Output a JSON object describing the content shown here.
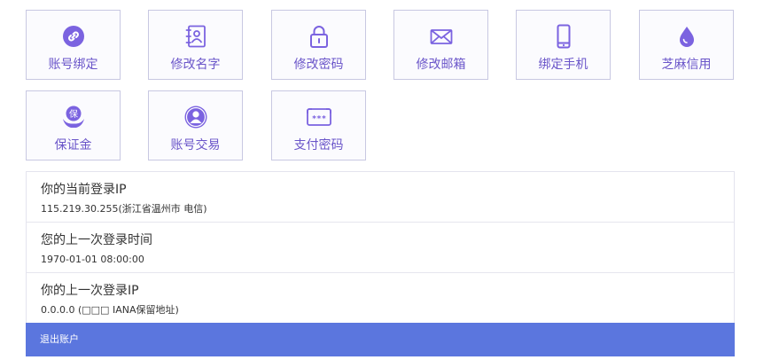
{
  "colors": {
    "accent": "#7b63e0",
    "tile_border": "#c8c8e2",
    "logout_bg": "#5b76de"
  },
  "tiles": [
    {
      "label": "账号绑定",
      "icon": "link-icon"
    },
    {
      "label": "修改名字",
      "icon": "contact-card-icon"
    },
    {
      "label": "修改密码",
      "icon": "lock-icon"
    },
    {
      "label": "修改邮箱",
      "icon": "envelope-icon"
    },
    {
      "label": "绑定手机",
      "icon": "phone-icon"
    },
    {
      "label": "芝麻信用",
      "icon": "drop-icon"
    },
    {
      "label": "保证金",
      "icon": "hands-guarantee-icon",
      "icon_char": "保"
    },
    {
      "label": "账号交易",
      "icon": "user-circle-icon"
    },
    {
      "label": "支付密码",
      "icon": "password-box-icon",
      "icon_text": "***"
    }
  ],
  "info": {
    "current_ip_title": "你的当前登录IP",
    "current_ip_value": "115.219.30.255(浙江省温州市 电信)",
    "last_time_title": "您的上一次登录时间",
    "last_time_value": "1970-01-01 08:00:00",
    "last_ip_title": "你的上一次登录IP",
    "last_ip_value": "0.0.0.0 (□□□ IANA保留地址)"
  },
  "logout_label": "退出账户"
}
